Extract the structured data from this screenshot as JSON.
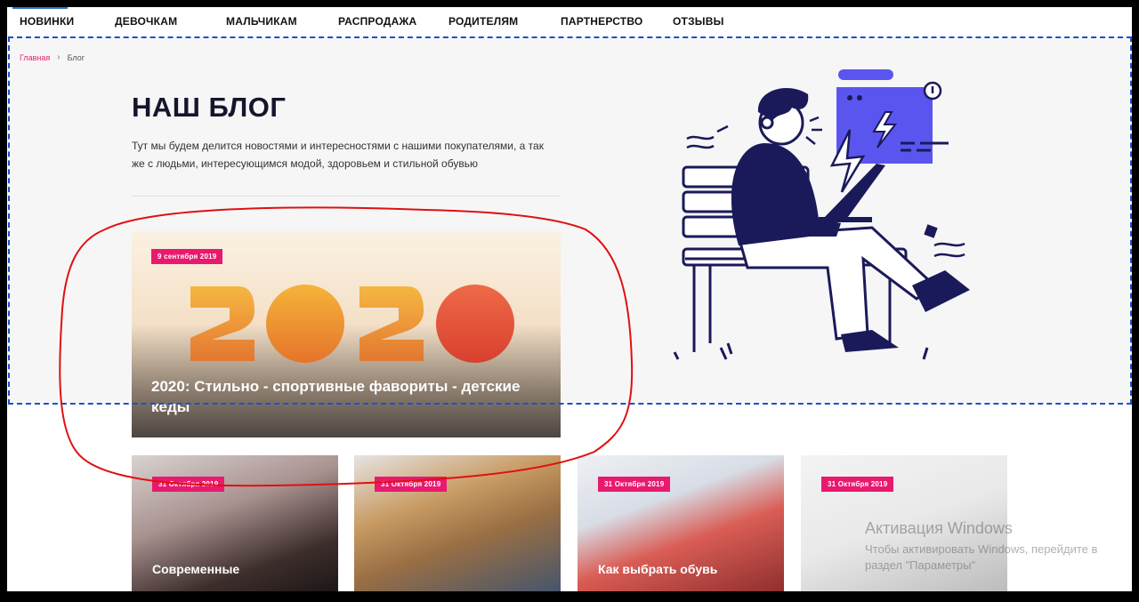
{
  "nav": {
    "items": [
      {
        "label": "НОВИНКИ",
        "active": true
      },
      {
        "label": "ДЕВОЧКАМ"
      },
      {
        "label": "МАЛЬЧИКАМ"
      },
      {
        "label": "РАСПРОДАЖА"
      },
      {
        "label": "РОДИТЕЛЯМ"
      },
      {
        "label": "ПАРТНЕРСТВО"
      },
      {
        "label": "ОТЗЫВЫ"
      }
    ]
  },
  "breadcrumb": {
    "home": "Главная",
    "separator": "›",
    "current": "Блог"
  },
  "page": {
    "title": "НАШ БЛОГ",
    "description": "Тут мы будем делится новостями и интересностями с нашими покупателями, а так же с людьми, интересующимся модой, здоровьем и стильной обувью"
  },
  "featured": {
    "date": "9 сентября 2019",
    "title": "2020: Стильно - спортивные фавориты - детские кеды"
  },
  "cards": [
    {
      "date": "31 Октября 2019",
      "title": "Современные"
    },
    {
      "date": "31 Октября 2019",
      "title": ""
    },
    {
      "date": "31 Октября 2019",
      "title": "Как выбрать обувь"
    },
    {
      "date": "31 Октября 2019",
      "title": ""
    }
  ],
  "watermark": {
    "title": "Активация Windows",
    "subtitle": "Чтобы активировать Windows, перейдите в раздел \"Параметры\""
  },
  "colors": {
    "accent": "#e8196e",
    "selection_box": "#1d4fd0",
    "annotation": "#e01010",
    "illustration_primary": "#1a1a5a",
    "illustration_accent": "#5b55f0"
  }
}
